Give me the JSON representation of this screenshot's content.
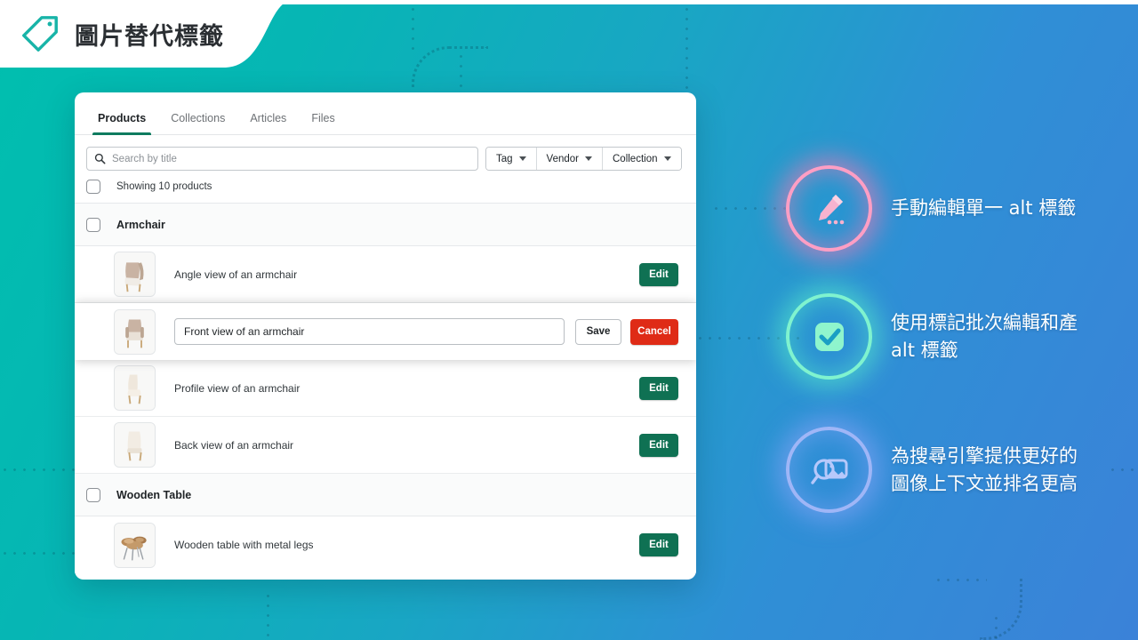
{
  "header": {
    "title": "圖片替代標籤",
    "icon": "tag-icon"
  },
  "app": {
    "tabs": [
      {
        "label": "Products",
        "active": true
      },
      {
        "label": "Collections",
        "active": false
      },
      {
        "label": "Articles",
        "active": false
      },
      {
        "label": "Files",
        "active": false
      }
    ],
    "search": {
      "placeholder": "Search by title",
      "value": "",
      "icon": "search-icon"
    },
    "filters": [
      {
        "label": "Tag"
      },
      {
        "label": "Vendor"
      },
      {
        "label": "Collection"
      }
    ],
    "showing_label": "Showing 10 products",
    "groups": [
      {
        "title": "Armchair",
        "rows": [
          {
            "alt": "Angle view of an armchair",
            "editing": false,
            "action": "Edit",
            "thumb": "armchair-angle"
          },
          {
            "alt": "Front view of an armchair",
            "editing": true,
            "save": "Save",
            "cancel": "Cancel",
            "thumb": "armchair-front"
          },
          {
            "alt": "Profile view of an armchair",
            "editing": false,
            "action": "Edit",
            "thumb": "armchair-profile"
          },
          {
            "alt": "Back view of an armchair",
            "editing": false,
            "action": "Edit",
            "thumb": "armchair-back"
          }
        ]
      },
      {
        "title": "Wooden Table",
        "rows": [
          {
            "alt": "Wooden table with metal legs",
            "editing": false,
            "action": "Edit",
            "thumb": "wooden-table"
          }
        ]
      }
    ]
  },
  "features": [
    {
      "id": "manual-edit",
      "text": "手動編輯單一 alt 標籤",
      "icon": "pencil-icon",
      "ring_color": "#ff9ec4",
      "glyph_color": "#f7b3cf"
    },
    {
      "id": "bulk-edit",
      "text": "使用標記批次編輯和產\nalt 標籤",
      "icon": "checkbox-icon",
      "ring_color": "#7ff3cf",
      "glyph_color": "#8ff5cd"
    },
    {
      "id": "seo-context",
      "text": "為搜尋引擎提供更好的\n圖像上下文並排名更高",
      "icon": "image-search-icon",
      "ring_color": "#9fb6f7",
      "glyph_color": "#b7c9fb"
    }
  ],
  "theme": {
    "bg_start": "#00bfae",
    "bg_end": "#3b82d8",
    "accent_green": "#0f7153",
    "danger_red": "#df2b16",
    "tab_underline": "#0f7b5f"
  }
}
